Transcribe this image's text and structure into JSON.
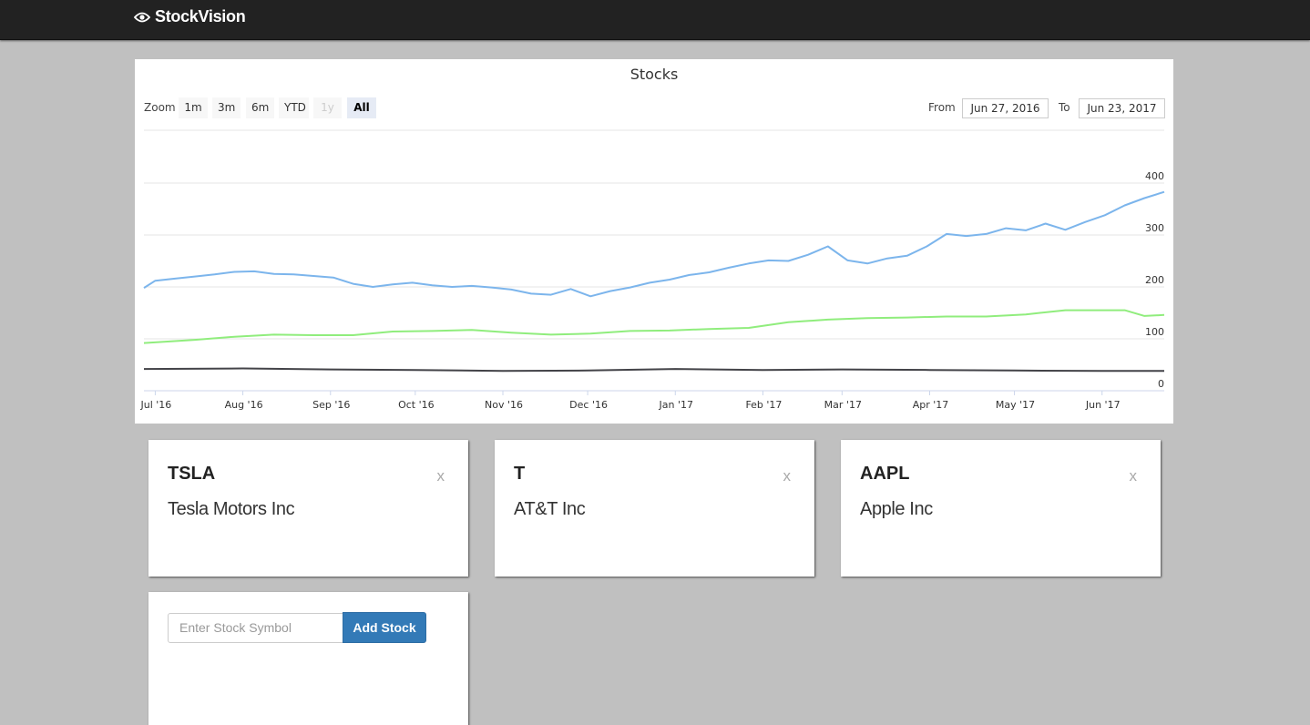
{
  "app": {
    "brand": "StockVision",
    "brand_icon": "eye-icon"
  },
  "chart_panel": {
    "zoom_label": "Zoom",
    "zoom_buttons": [
      {
        "label": "1m",
        "state": "normal"
      },
      {
        "label": "3m",
        "state": "normal"
      },
      {
        "label": "6m",
        "state": "normal"
      },
      {
        "label": "YTD",
        "state": "normal"
      },
      {
        "label": "1y",
        "state": "disabled"
      },
      {
        "label": "All",
        "state": "active"
      }
    ],
    "from_label": "From",
    "from_value": "Jun 27, 2016",
    "to_label": "To",
    "to_value": "Jun 23, 2017"
  },
  "chart_data": {
    "type": "line",
    "title": "Stocks",
    "xlabel": "",
    "ylabel": "",
    "ylim": [
      0,
      400
    ],
    "y_ticks": [
      "0",
      "100",
      "200",
      "300",
      "400"
    ],
    "x_ticks": [
      "Jul '16",
      "Aug '16",
      "Sep '16",
      "Oct '16",
      "Nov '16",
      "Dec '16",
      "Jan '17",
      "Feb '17",
      "Mar '17",
      "Apr '17",
      "May '17",
      "Jun '17"
    ],
    "x_range": [
      "2016-06-27",
      "2017-06-23"
    ],
    "grid": true,
    "series": [
      {
        "color": "#7cb5ec",
        "points": [
          [
            "2016-06-27",
            198
          ],
          [
            "2016-07-01",
            212
          ],
          [
            "2016-07-08",
            216
          ],
          [
            "2016-07-15",
            220
          ],
          [
            "2016-07-22",
            224
          ],
          [
            "2016-07-29",
            229
          ],
          [
            "2016-08-05",
            230
          ],
          [
            "2016-08-12",
            225
          ],
          [
            "2016-08-19",
            224
          ],
          [
            "2016-08-26",
            221
          ],
          [
            "2016-09-02",
            218
          ],
          [
            "2016-09-09",
            206
          ],
          [
            "2016-09-16",
            200
          ],
          [
            "2016-09-23",
            205
          ],
          [
            "2016-09-30",
            208
          ],
          [
            "2016-10-07",
            203
          ],
          [
            "2016-10-14",
            200
          ],
          [
            "2016-10-21",
            202
          ],
          [
            "2016-10-28",
            199
          ],
          [
            "2016-11-04",
            195
          ],
          [
            "2016-11-11",
            187
          ],
          [
            "2016-11-18",
            185
          ],
          [
            "2016-11-25",
            196
          ],
          [
            "2016-12-02",
            182
          ],
          [
            "2016-12-09",
            192
          ],
          [
            "2016-12-16",
            199
          ],
          [
            "2016-12-23",
            208
          ],
          [
            "2016-12-30",
            214
          ],
          [
            "2017-01-06",
            223
          ],
          [
            "2017-01-13",
            228
          ],
          [
            "2017-01-20",
            237
          ],
          [
            "2017-01-27",
            245
          ],
          [
            "2017-02-03",
            251
          ],
          [
            "2017-02-10",
            250
          ],
          [
            "2017-02-17",
            262
          ],
          [
            "2017-02-24",
            278
          ],
          [
            "2017-03-03",
            251
          ],
          [
            "2017-03-10",
            245
          ],
          [
            "2017-03-17",
            255
          ],
          [
            "2017-03-24",
            260
          ],
          [
            "2017-03-31",
            278
          ],
          [
            "2017-04-07",
            302
          ],
          [
            "2017-04-14",
            298
          ],
          [
            "2017-04-21",
            302
          ],
          [
            "2017-04-28",
            313
          ],
          [
            "2017-05-05",
            309
          ],
          [
            "2017-05-12",
            322
          ],
          [
            "2017-05-19",
            310
          ],
          [
            "2017-05-26",
            325
          ],
          [
            "2017-06-02",
            338
          ],
          [
            "2017-06-09",
            357
          ],
          [
            "2017-06-16",
            371
          ],
          [
            "2017-06-23",
            383
          ]
        ]
      },
      {
        "color": "#90ed7d",
        "points": [
          [
            "2016-06-27",
            92
          ],
          [
            "2016-07-15",
            98
          ],
          [
            "2016-07-29",
            104
          ],
          [
            "2016-08-12",
            108
          ],
          [
            "2016-08-26",
            107
          ],
          [
            "2016-09-09",
            107
          ],
          [
            "2016-09-23",
            114
          ],
          [
            "2016-10-07",
            115
          ],
          [
            "2016-10-21",
            117
          ],
          [
            "2016-11-04",
            112
          ],
          [
            "2016-11-18",
            108
          ],
          [
            "2016-12-02",
            110
          ],
          [
            "2016-12-16",
            115
          ],
          [
            "2016-12-30",
            116
          ],
          [
            "2017-01-13",
            119
          ],
          [
            "2017-01-27",
            121
          ],
          [
            "2017-02-10",
            132
          ],
          [
            "2017-02-24",
            137
          ],
          [
            "2017-03-10",
            140
          ],
          [
            "2017-03-24",
            141
          ],
          [
            "2017-04-07",
            143
          ],
          [
            "2017-04-21",
            143
          ],
          [
            "2017-05-05",
            147
          ],
          [
            "2017-05-19",
            155
          ],
          [
            "2017-06-02",
            155
          ],
          [
            "2017-06-09",
            155
          ],
          [
            "2017-06-16",
            144
          ],
          [
            "2017-06-23",
            146
          ]
        ]
      },
      {
        "color": "#434348",
        "points": [
          [
            "2016-06-27",
            42
          ],
          [
            "2016-08-01",
            43
          ],
          [
            "2016-09-01",
            41
          ],
          [
            "2016-10-01",
            40
          ],
          [
            "2016-11-01",
            38
          ],
          [
            "2016-12-01",
            39
          ],
          [
            "2017-01-01",
            42
          ],
          [
            "2017-02-01",
            40
          ],
          [
            "2017-03-01",
            41
          ],
          [
            "2017-04-01",
            40
          ],
          [
            "2017-05-01",
            39
          ],
          [
            "2017-06-01",
            38
          ],
          [
            "2017-06-23",
            38
          ]
        ]
      }
    ]
  },
  "stocks": [
    {
      "symbol": "TSLA",
      "name": "Tesla Motors Inc",
      "close": "x"
    },
    {
      "symbol": "T",
      "name": "AT&T Inc",
      "close": "x"
    },
    {
      "symbol": "AAPL",
      "name": "Apple Inc",
      "close": "x"
    }
  ],
  "add_stock": {
    "placeholder": "Enter Stock Symbol",
    "button_label": "Add Stock"
  }
}
